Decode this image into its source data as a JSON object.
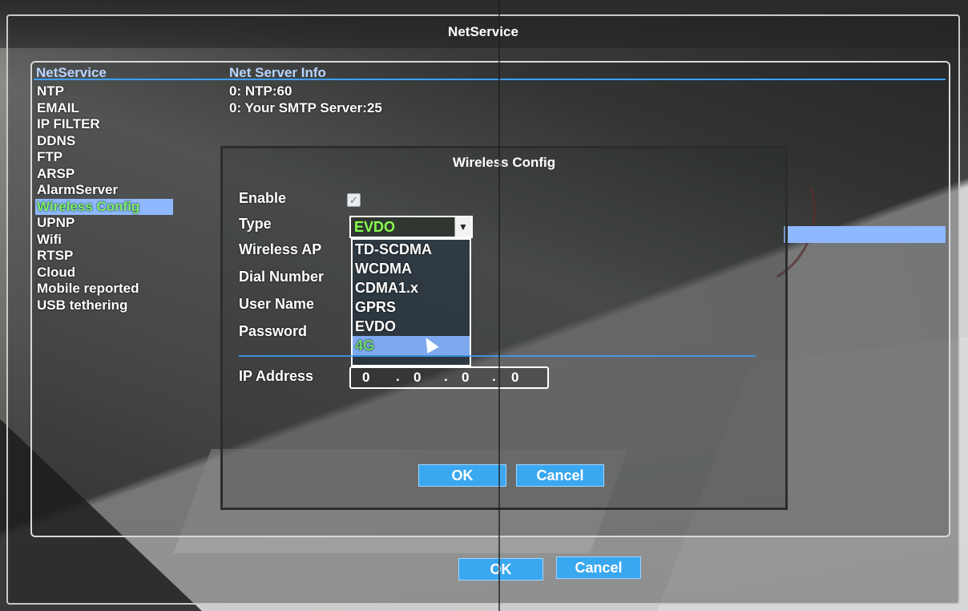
{
  "window": {
    "title": "NetService"
  },
  "list": {
    "col1_header": "NetService",
    "col2_header": "Net Server Info",
    "items": [
      {
        "label": "NTP"
      },
      {
        "label": "EMAIL"
      },
      {
        "label": "IP FILTER"
      },
      {
        "label": "DDNS"
      },
      {
        "label": "FTP"
      },
      {
        "label": "ARSP"
      },
      {
        "label": "AlarmServer"
      },
      {
        "label": "Wireless Config",
        "selected": true
      },
      {
        "label": "UPNP"
      },
      {
        "label": "Wifi"
      },
      {
        "label": "RTSP"
      },
      {
        "label": "Cloud"
      },
      {
        "label": "Mobile reported"
      },
      {
        "label": "USB tethering"
      }
    ],
    "info": [
      "0: NTP:60",
      "0: Your SMTP Server:25"
    ]
  },
  "dialog": {
    "title": "Wireless Config",
    "enable_label": "Enable",
    "enable_checked": true,
    "type_label": "Type",
    "type_value": "EVDO",
    "wireless_ap_label": "Wireless AP",
    "dial_number_label": "Dial Number",
    "user_name_label": "User Name",
    "password_label": "Password",
    "ip_label": "IP Address",
    "ip": [
      "0",
      "0",
      "0",
      "0"
    ],
    "type_options": [
      "TD-SCDMA",
      "WCDMA",
      "CDMA1.x",
      "GPRS",
      "EVDO",
      "4G"
    ],
    "highlighted_option": "4G",
    "ok_label": "OK",
    "cancel_label": "Cancel"
  },
  "footer": {
    "ok_label": "OK",
    "cancel_label": "Cancel"
  },
  "colors": {
    "accent": "#3aa8f0",
    "selection": "#8fb8ff",
    "selected_text": "#7cf266"
  }
}
